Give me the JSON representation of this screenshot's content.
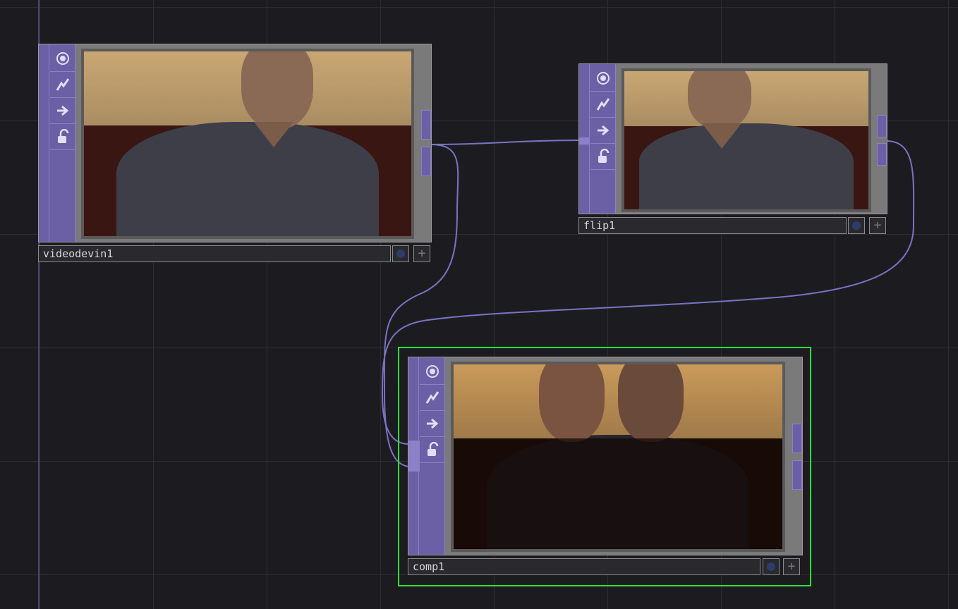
{
  "network": {
    "nodes": [
      {
        "id": "videodevin1",
        "label": "videodevin1"
      },
      {
        "id": "flip1",
        "label": "flip1"
      },
      {
        "id": "comp1",
        "label": "comp1",
        "selected": true
      }
    ],
    "connections": [
      {
        "from": "videodevin1",
        "to": "flip1"
      },
      {
        "from": "videodevin1",
        "to": "comp1"
      },
      {
        "from": "flip1",
        "to": "comp1"
      }
    ],
    "node_flags": [
      "viewer-icon",
      "bypass-icon",
      "display-arrow-icon",
      "lock-icon"
    ]
  },
  "colors": {
    "background": "#1c1c20",
    "grid": "#2c2c32",
    "node_purple": "#6b5fa6",
    "wire": "#7b72c4",
    "selected": "#26e03c"
  }
}
